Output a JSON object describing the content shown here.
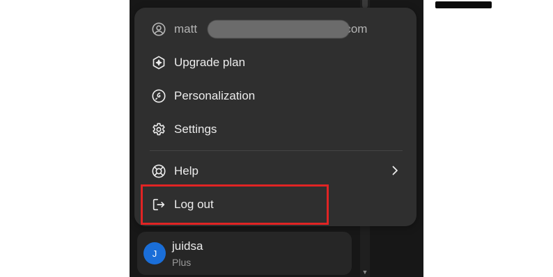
{
  "colors": {
    "app_background": "#171717",
    "menu_background": "#2f2f2f",
    "menu_text": "#ececec",
    "muted_text": "#b4b4b4",
    "divider": "#454545",
    "highlight_border": "#e02424",
    "avatar_background": "#1a6ed8"
  },
  "menu": {
    "account": {
      "email_prefix": "matt",
      "email_suffix": "il.com",
      "email_redacted": true,
      "icon": "user-circle-icon"
    },
    "items": [
      {
        "label": "Upgrade plan",
        "icon": "upgrade-sparkle-icon"
      },
      {
        "label": "Personalization",
        "icon": "personalization-icon"
      },
      {
        "label": "Settings",
        "icon": "gear-icon"
      },
      {
        "label": "Help",
        "icon": "lifebuoy-icon",
        "submenu_indicator": "chevron-right-icon"
      },
      {
        "label": "Log out",
        "icon": "logout-icon",
        "highlighted": true
      }
    ]
  },
  "user": {
    "avatar_initial": "J",
    "name": "juidsa",
    "plan": "Plus"
  }
}
